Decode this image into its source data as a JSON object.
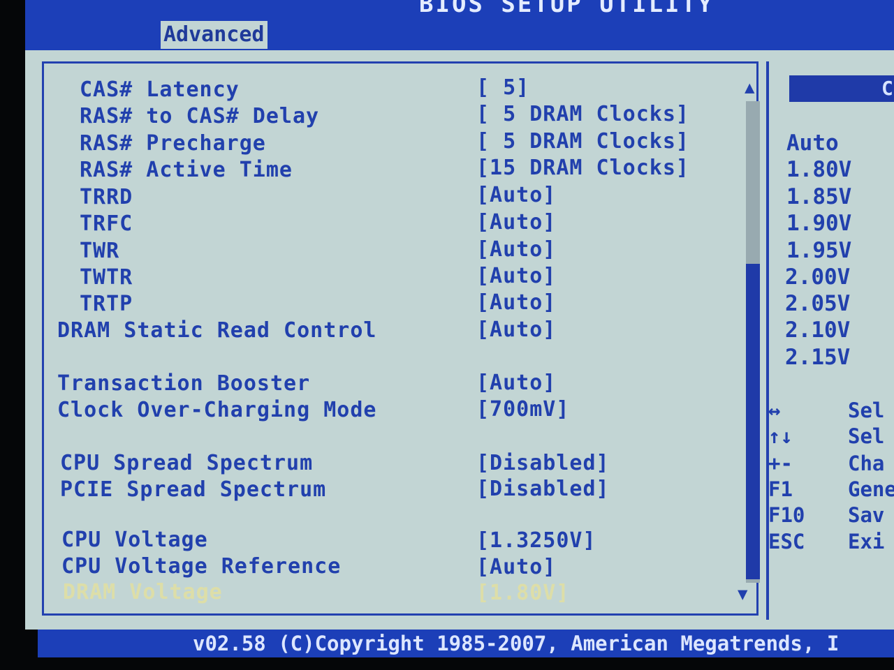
{
  "header": {
    "title": "BIOS SETUP UTILITY",
    "active_tab": "Advanced"
  },
  "settings": [
    {
      "label": "CAS# Latency",
      "value": "[ 5]"
    },
    {
      "label": "RAS# to CAS# Delay",
      "value": "[ 5 DRAM Clocks]"
    },
    {
      "label": "RAS# Precharge",
      "value": "[ 5 DRAM Clocks]"
    },
    {
      "label": "RAS# Active Time",
      "value": "[15 DRAM Clocks]"
    },
    {
      "label": "TRRD",
      "value": "[Auto]"
    },
    {
      "label": "TRFC",
      "value": "[Auto]"
    },
    {
      "label": "TWR",
      "value": "[Auto]"
    },
    {
      "label": "TWTR",
      "value": "[Auto]"
    },
    {
      "label": "TRTP",
      "value": "[Auto]"
    },
    {
      "label": "DRAM Static Read Control",
      "value": "[Auto]"
    },
    {
      "label": "Transaction Booster",
      "value": "[Auto]"
    },
    {
      "label": "Clock Over-Charging Mode",
      "value": "[700mV]"
    },
    {
      "label": "CPU Spread Spectrum",
      "value": "[Disabled]"
    },
    {
      "label": "PCIE Spread Spectrum",
      "value": "[Disabled]"
    },
    {
      "label": "CPU Voltage",
      "value": "[1.3250V]"
    },
    {
      "label": "CPU Voltage Reference",
      "value": "[Auto]"
    },
    {
      "label": "DRAM Voltage",
      "value": "[1.80V]",
      "selected": true
    }
  ],
  "options_panel": {
    "header": "C",
    "options": [
      "Auto",
      "1.80V",
      "1.85V",
      "1.90V",
      "1.95V",
      "2.00V",
      "2.05V",
      "2.10V",
      "2.15V"
    ]
  },
  "key_help": [
    {
      "key": "↔",
      "desc": "Sel"
    },
    {
      "key": "↑↓",
      "desc": "Sel"
    },
    {
      "key": "+-",
      "desc": "Cha"
    },
    {
      "key": "F1",
      "desc": "Gene"
    },
    {
      "key": "F10",
      "desc": "Sav"
    },
    {
      "key": "ESC",
      "desc": "Exi"
    }
  ],
  "scrollbar": {
    "up_icon": "▲",
    "down_icon": "▼",
    "position_fraction": 1.0
  },
  "footer": {
    "text": "v02.58 (C)Copyright 1985-2007, American Megatrends, I"
  },
  "colors": {
    "background": "#c2d5d4",
    "bar": "#1c3fb8",
    "text": "#2140ad",
    "selected": "#e6e29a"
  }
}
